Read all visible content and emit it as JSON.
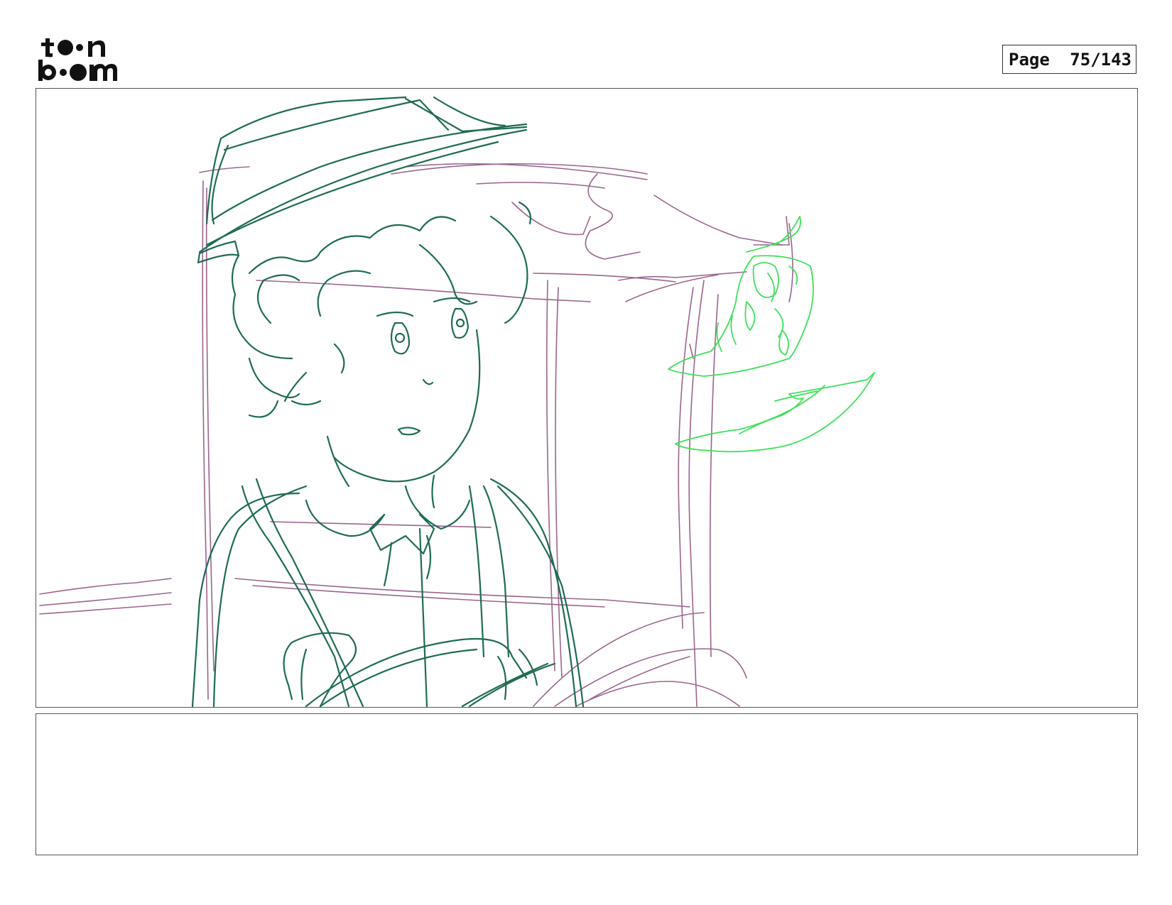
{
  "header": {
    "logo": {
      "icon": "toon-boom-logo",
      "line1": "toon",
      "line2": "boom"
    },
    "page_label": "Page",
    "page_number": "75/143"
  },
  "panel": {
    "description_icon": "storyboard-sketch",
    "colors": {
      "character_line": "#1e6b55",
      "background_line": "#8a4a7a",
      "magic_line": "#3ee05a"
    }
  },
  "notes": {
    "text": ""
  }
}
